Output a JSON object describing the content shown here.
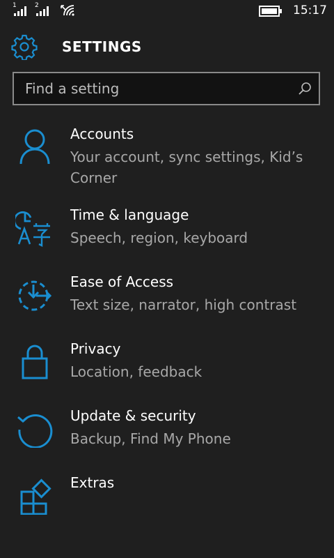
{
  "status_bar": {
    "sim1_label": "1",
    "sim2_label": "2",
    "time": "15:17"
  },
  "header": {
    "title": "SETTINGS"
  },
  "search": {
    "placeholder": "Find a setting"
  },
  "accent_color": "#1a8ed0",
  "items": [
    {
      "icon": "person-icon",
      "title": "Accounts",
      "description": "Your account, sync settings, Kid’s Corner"
    },
    {
      "icon": "time-language-icon",
      "title": "Time & language",
      "description": "Speech, region, keyboard"
    },
    {
      "icon": "ease-of-access-icon",
      "title": "Ease of Access",
      "description": "Text size, narrator, high contrast"
    },
    {
      "icon": "lock-icon",
      "title": "Privacy",
      "description": "Location, feedback"
    },
    {
      "icon": "update-icon",
      "title": "Update & security",
      "description": "Backup, Find My Phone"
    },
    {
      "icon": "extras-icon",
      "title": "Extras",
      "description": ""
    }
  ]
}
